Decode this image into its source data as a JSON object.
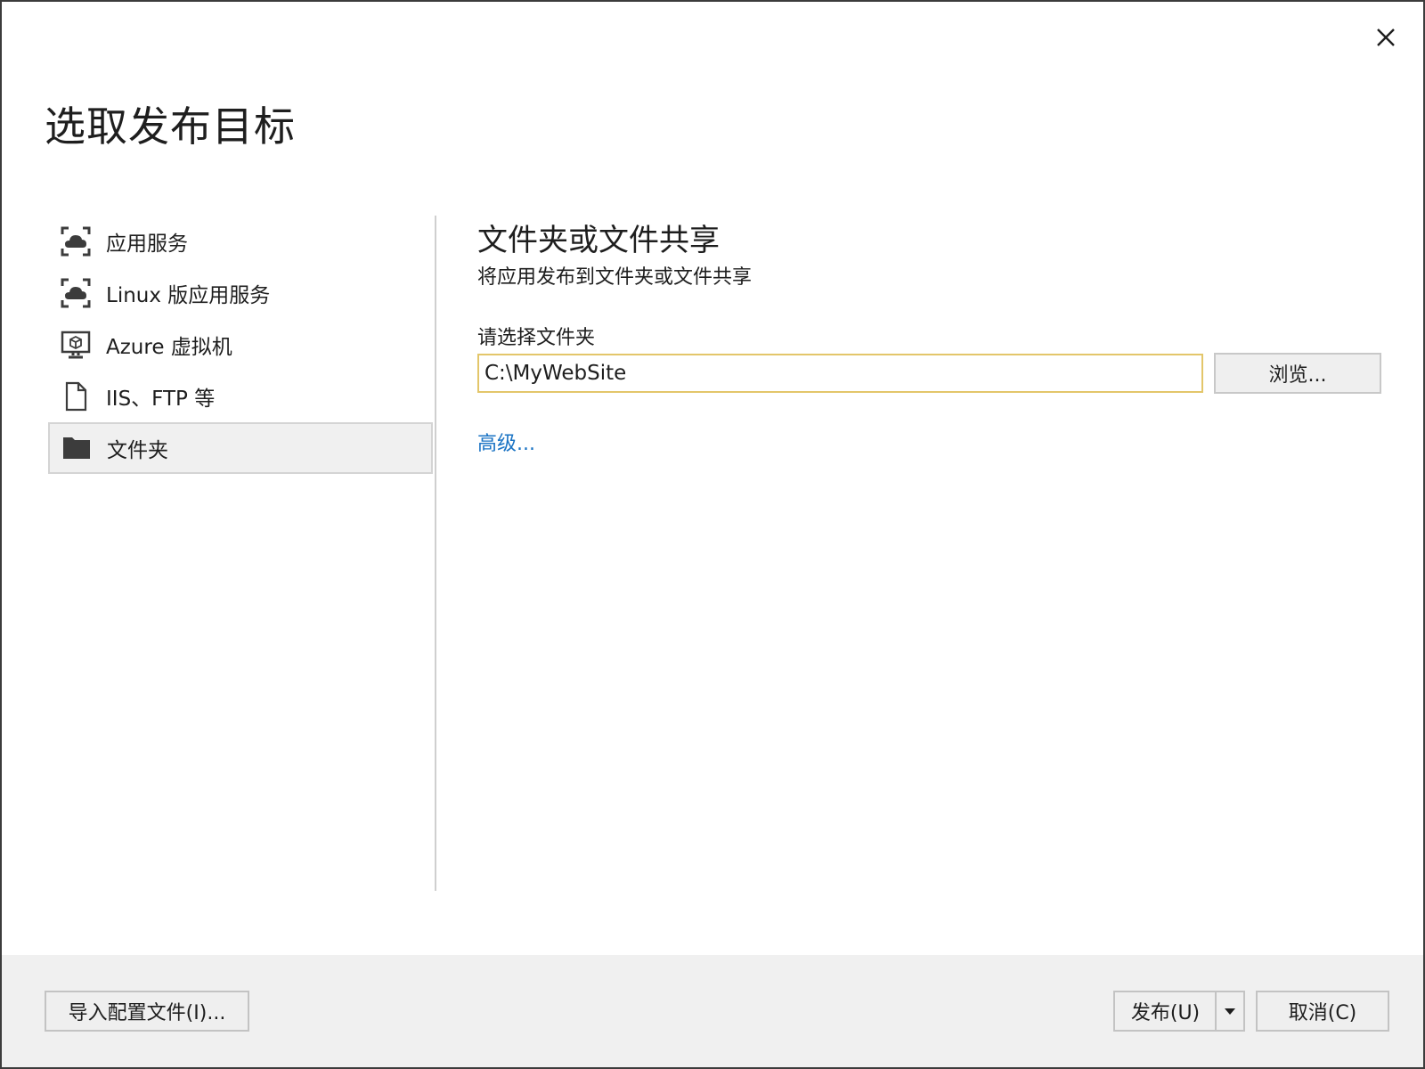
{
  "dialog": {
    "title": "选取发布目标",
    "close_symbol": "✕"
  },
  "sidebar": {
    "items": [
      {
        "label": "应用服务",
        "icon": "app-service-icon",
        "selected": false
      },
      {
        "label": "Linux 版应用服务",
        "icon": "app-service-linux-icon",
        "selected": false
      },
      {
        "label": "Azure 虚拟机",
        "icon": "virtual-machine-icon",
        "selected": false
      },
      {
        "label": "IIS、FTP 等",
        "icon": "document-icon",
        "selected": false
      },
      {
        "label": "文件夹",
        "icon": "folder-icon",
        "selected": true
      }
    ]
  },
  "main": {
    "title": "文件夹或文件共享",
    "subtitle": "将应用发布到文件夹或文件共享",
    "folder_label": "请选择文件夹",
    "folder_value": "C:\\MyWebSite",
    "browse_label": "浏览...",
    "advanced_link": "高级..."
  },
  "footer": {
    "import_label": "导入配置文件(I)...",
    "publish_label": "发布(U)",
    "cancel_label": "取消(C)"
  },
  "colors": {
    "selected_bg": "#f0f0f0",
    "input_border": "#e3c66a",
    "link": "#1a73c4",
    "footer_bg": "#f0f0f0",
    "icon": "#3c3c3c"
  }
}
